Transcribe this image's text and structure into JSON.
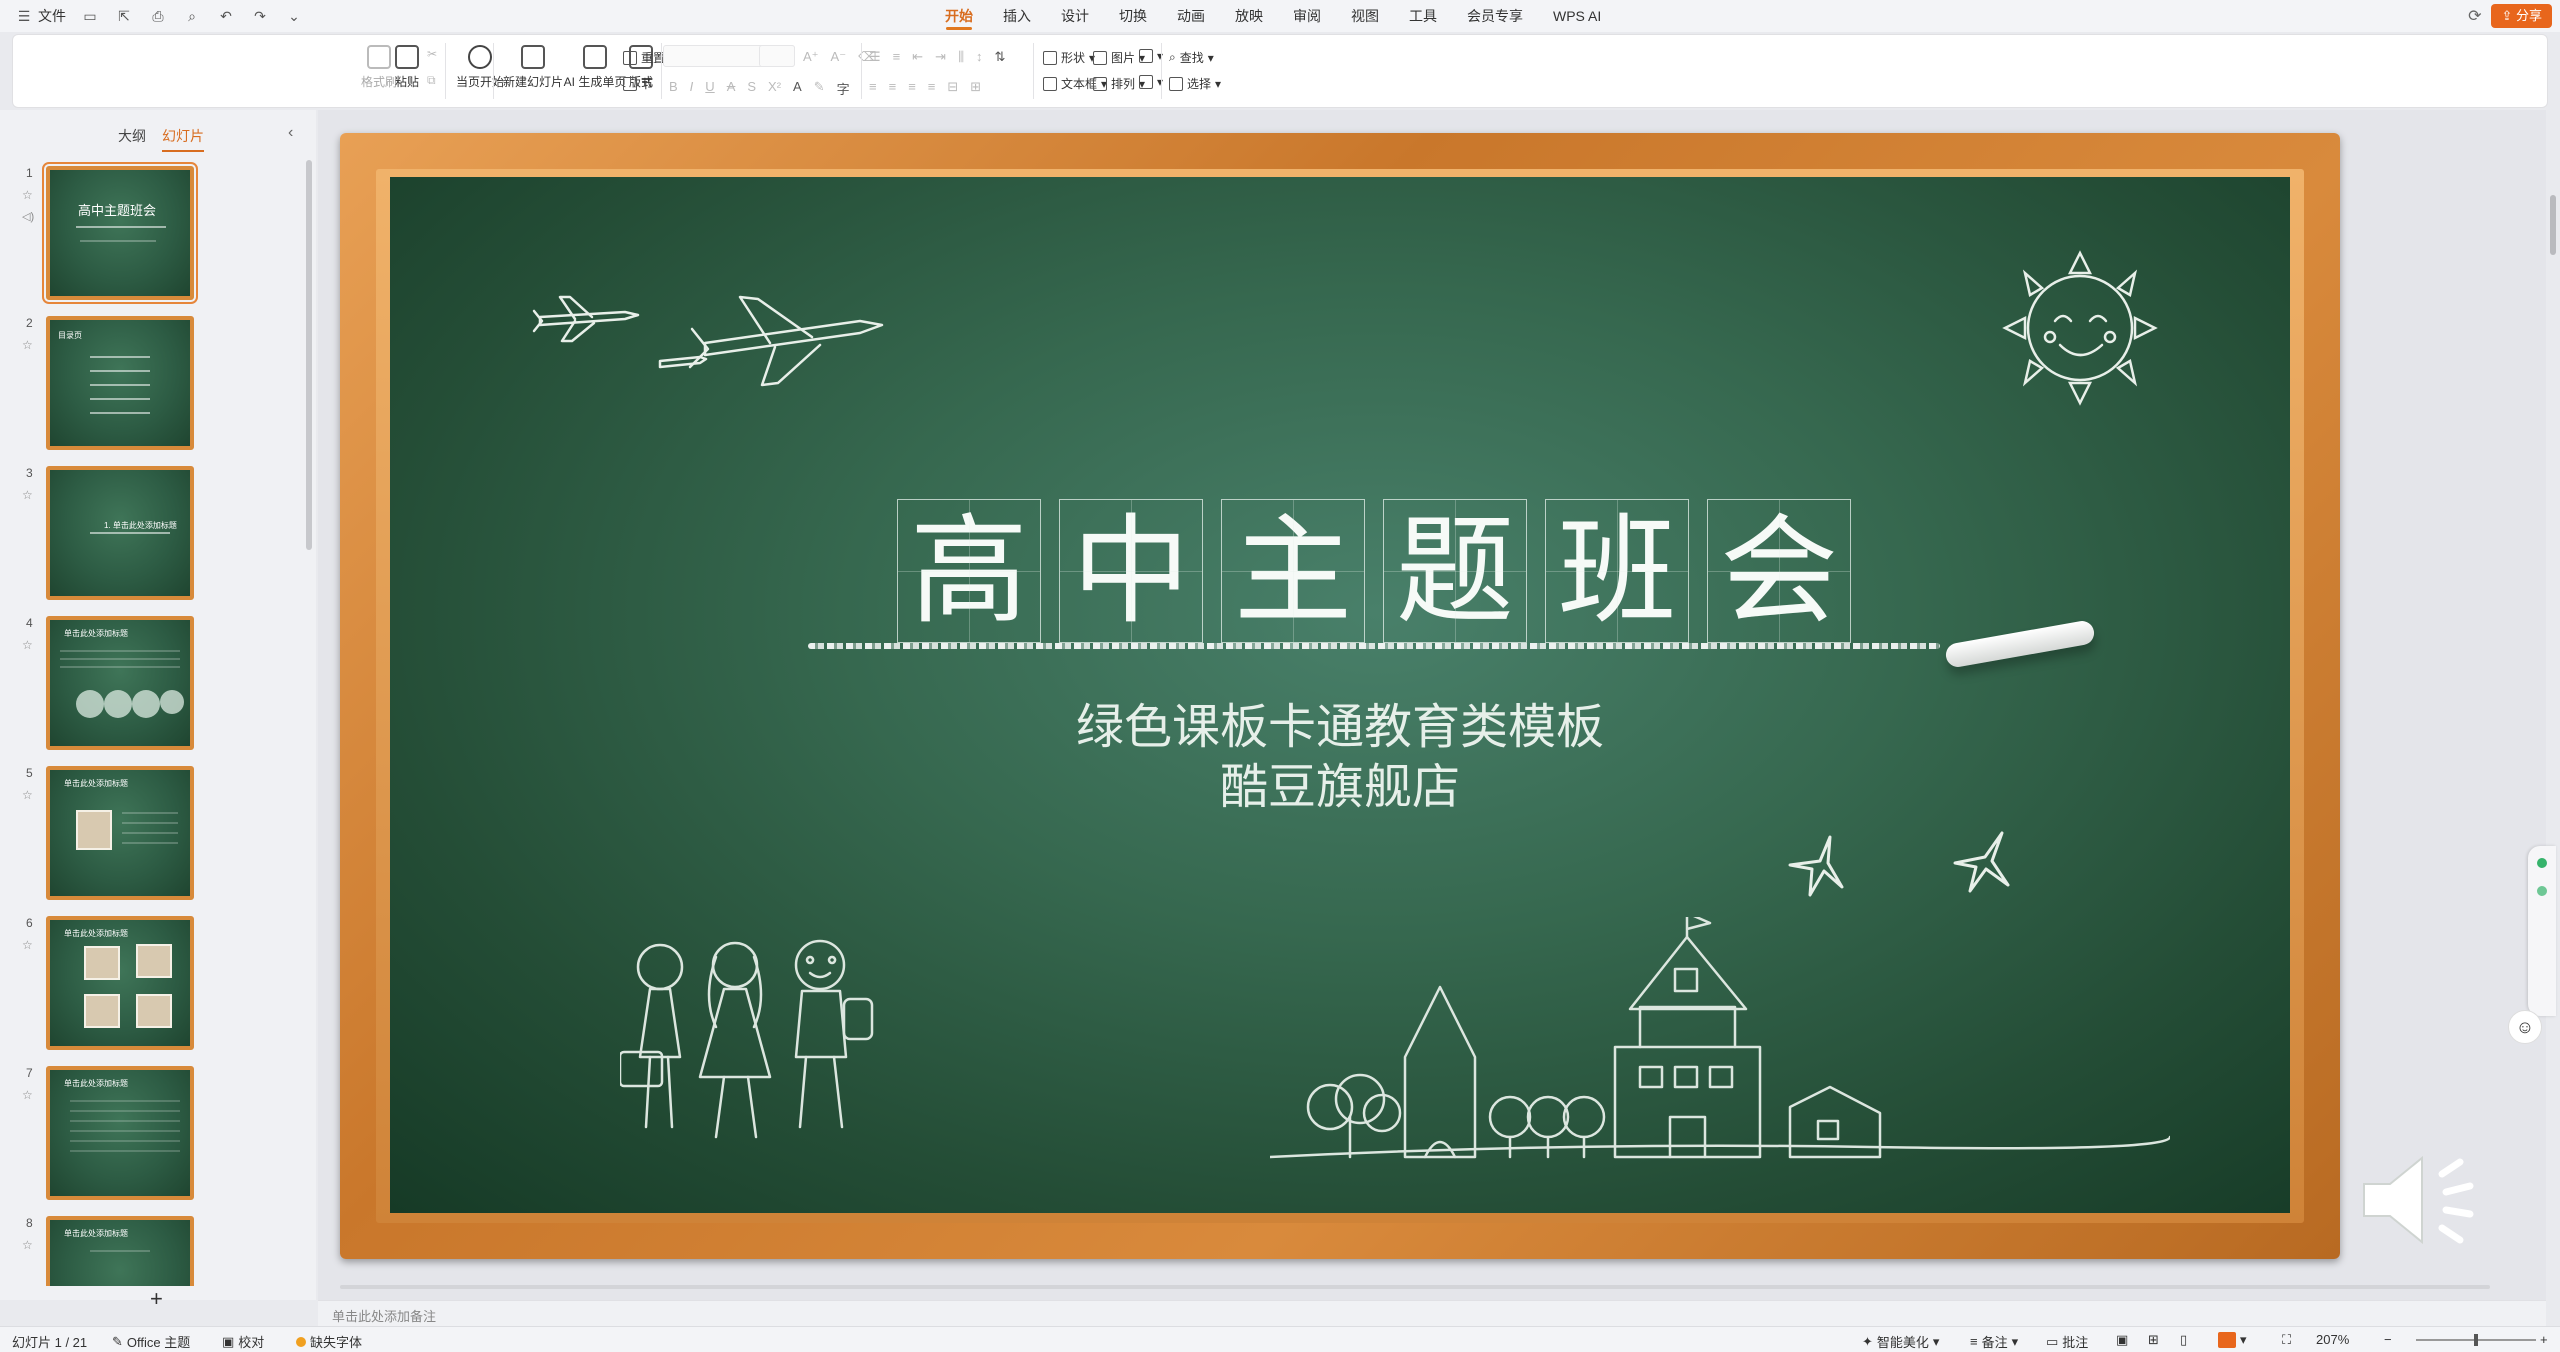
{
  "menubar": {
    "file_label": "文件",
    "tabs": [
      {
        "label": "开始",
        "active": true
      },
      {
        "label": "插入"
      },
      {
        "label": "设计"
      },
      {
        "label": "切换"
      },
      {
        "label": "动画"
      },
      {
        "label": "放映"
      },
      {
        "label": "审阅"
      },
      {
        "label": "视图"
      },
      {
        "label": "工具"
      },
      {
        "label": "会员专享"
      },
      {
        "label": "WPS AI"
      }
    ],
    "share_label": "分享"
  },
  "ribbon": {
    "format_painter": "格式刷",
    "paste": "粘贴",
    "start_from_current": "当页开始",
    "new_slide": "新建幻灯片",
    "ai_generate": "AI 生成单页",
    "layout": "版式",
    "reset": "重置",
    "section": "节",
    "shape": "形状",
    "picture": "图片",
    "textbox": "文本框",
    "arrange": "排列",
    "find": "查找",
    "select": "选择"
  },
  "leftpanel": {
    "tab_outline": "大纲",
    "tab_slides": "幻灯片",
    "slides": [
      {
        "num": "1",
        "title": "高中主题班会"
      },
      {
        "num": "2",
        "title": "目录页"
      },
      {
        "num": "3",
        "title": "1. 单击此处添加标题"
      },
      {
        "num": "4",
        "title": "单击此处添加标题"
      },
      {
        "num": "5",
        "title": "单击此处添加标题"
      },
      {
        "num": "6",
        "title": "单击此处添加标题"
      },
      {
        "num": "7",
        "title": "单击此处添加标题"
      },
      {
        "num": "8",
        "title": "单击此处添加标题"
      }
    ]
  },
  "slide": {
    "title_chars": [
      "高",
      "中",
      "主",
      "题",
      "班",
      "会"
    ],
    "subtitle1": "绿色课板卡通教育类模板",
    "subtitle2": "酷豆旗舰店"
  },
  "notes": {
    "placeholder": "单击此处添加备注"
  },
  "statusbar": {
    "slide_counter": "幻灯片 1 / 21",
    "theme": "Office 主题",
    "proofing": "校对",
    "missing_font": "缺失字体",
    "smart_beautify": "智能美化",
    "notes_label": "备注",
    "comments_label": "批注",
    "zoom": "207%"
  },
  "colors": {
    "accent": "#d86d20",
    "board": "#2d5c44",
    "frame": "#d98a3c"
  }
}
